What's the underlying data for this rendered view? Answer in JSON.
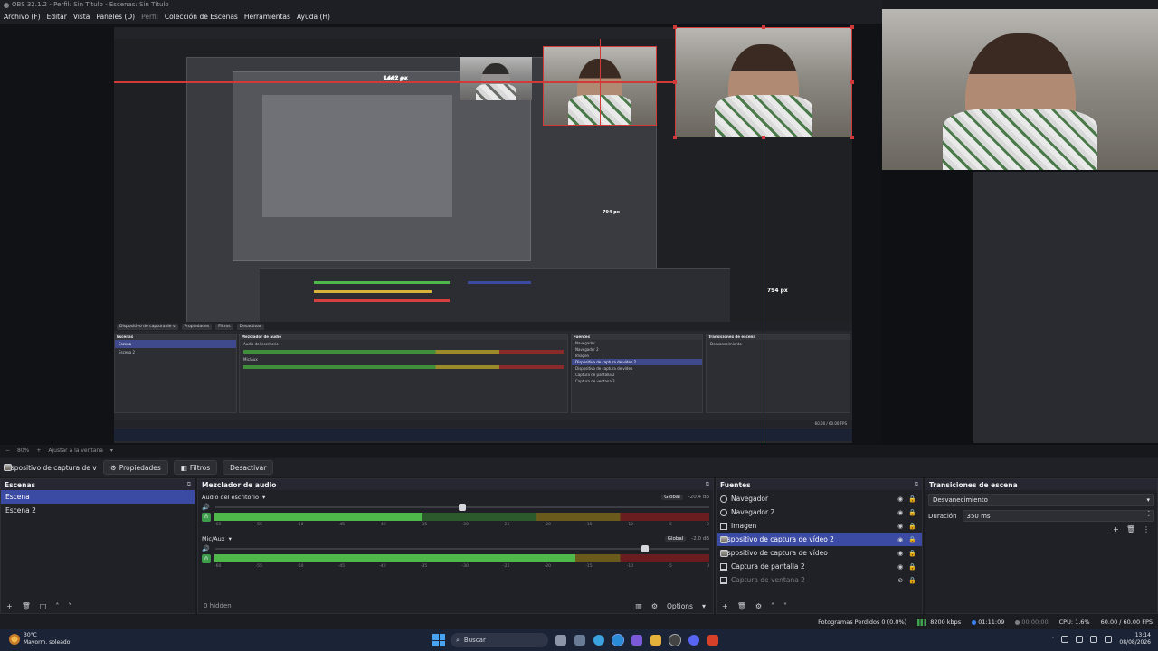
{
  "window": {
    "title": "OBS 32.1.2 - Perfil: Sin Título - Escenas: Sin Título"
  },
  "menu": [
    {
      "label": "Archivo (F)",
      "dim": false
    },
    {
      "label": "Editar",
      "dim": false
    },
    {
      "label": "Vista",
      "dim": false
    },
    {
      "label": "Paneles (D)",
      "dim": false
    },
    {
      "label": "Perfil",
      "dim": true
    },
    {
      "label": "Colección de Escenas",
      "dim": false
    },
    {
      "label": "Herramientas",
      "dim": false
    },
    {
      "label": "Ayuda (H)",
      "dim": false
    }
  ],
  "preview": {
    "width_label": "1462 px",
    "height_label": "794 px",
    "height_label_small": "794 px"
  },
  "zoombar": {
    "zoom": "80%",
    "fit_label": "Ajustar a la ventana"
  },
  "source_toolbar": {
    "source_name": "Dispositivo de captura de v",
    "properties": "Propiedades",
    "filters": "Filtros",
    "deactivate": "Desactivar"
  },
  "scenes": {
    "title": "Escenas",
    "items": [
      {
        "label": "Escena",
        "selected": true
      },
      {
        "label": "Escena 2",
        "selected": false
      }
    ]
  },
  "mixer": {
    "title": "Mezclador de audio",
    "hidden_label": "0 hidden",
    "options_label": "Options",
    "tick_labels": [
      "-60",
      "-55",
      "-50",
      "-45",
      "-40",
      "-35",
      "-30",
      "-25",
      "-20",
      "-15",
      "-10",
      "-5",
      "0"
    ],
    "tracks": [
      {
        "name": "Audio del escritorio",
        "badge": "Global",
        "db": "-20.4 dB",
        "volume": 0.5,
        "level": 0.42
      },
      {
        "name": "Mic/Aux",
        "badge": "Global",
        "db": "-2.0 dB",
        "volume": 0.87,
        "level": 0.73
      }
    ]
  },
  "sources": {
    "title": "Fuentes",
    "items": [
      {
        "label": "Navegador",
        "icon": "globe-icon",
        "selected": false,
        "dim": false
      },
      {
        "label": "Navegador 2",
        "icon": "globe-icon",
        "selected": false,
        "dim": false
      },
      {
        "label": "Imagen",
        "icon": "image-icon",
        "selected": false,
        "dim": false
      },
      {
        "label": "Dispositivo de captura de vídeo 2",
        "icon": "camera-icon",
        "selected": true,
        "dim": false
      },
      {
        "label": "Dispositivo de captura de vídeo",
        "icon": "camera-icon",
        "selected": false,
        "dim": false
      },
      {
        "label": "Captura de pantalla 2",
        "icon": "monitor-icon",
        "selected": false,
        "dim": false
      },
      {
        "label": "Captura de ventana 2",
        "icon": "monitor-icon",
        "selected": false,
        "dim": true
      }
    ]
  },
  "transitions": {
    "title": "Transiciones de escena",
    "selected": "Desvanecimiento",
    "duration_label": "Duración",
    "duration_value": "350 ms"
  },
  "status": {
    "dropped_frames": "Fotogramas Perdidos 0 (0.0%)",
    "bitrate": "8200 kbps",
    "stream_time": "01:11:09",
    "rec_time": "00:00:00",
    "cpu": "CPU: 1.6%",
    "fps": "60.00 / 60.00 FPS"
  },
  "taskbar": {
    "temp": "30°C",
    "weather": "Mayorm. soleado",
    "search_placeholder": "Buscar",
    "time": "13:14",
    "date": "08/08/2026"
  },
  "colors": {
    "accent_selection": "#3b4aa3",
    "guide_red": "#d23a3a",
    "meter_green": "#4fb84b",
    "meter_yellow": "#d9b23a",
    "meter_red": "#d84040"
  }
}
